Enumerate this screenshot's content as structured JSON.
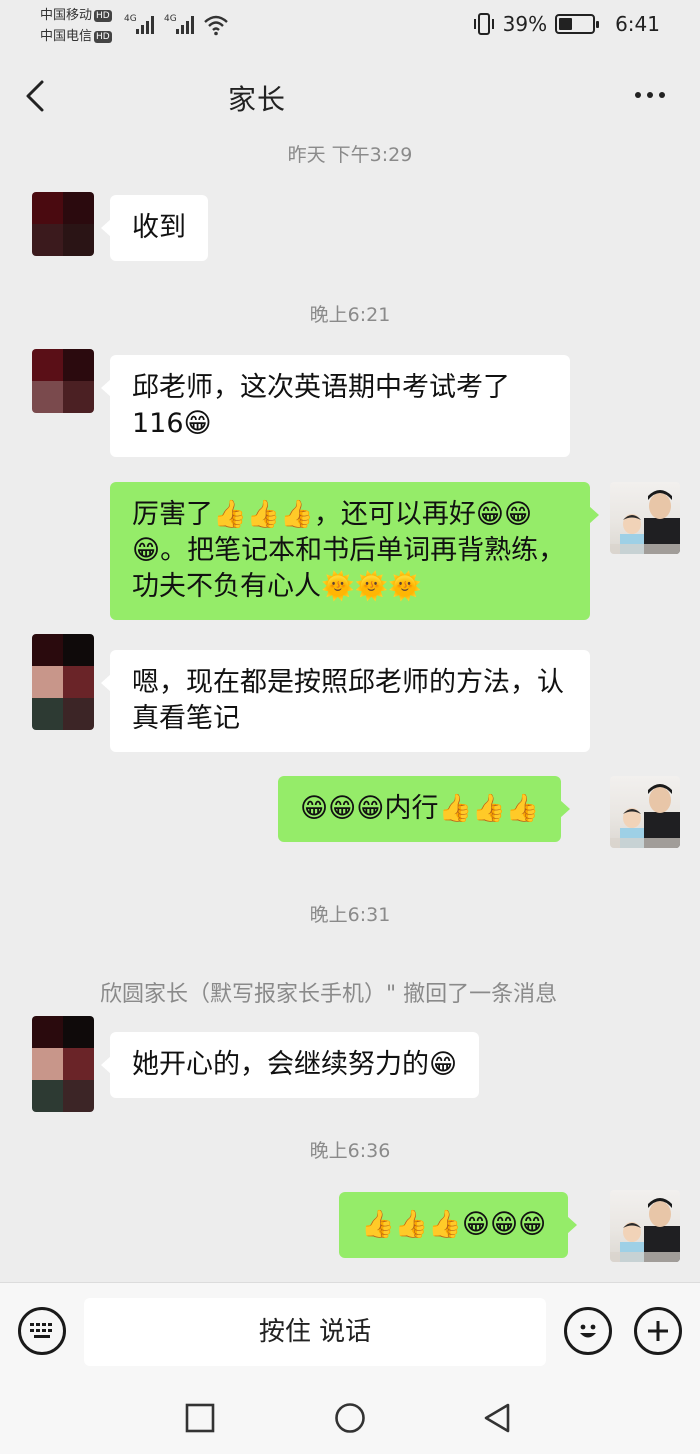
{
  "status_bar": {
    "carrier1": "中国移动",
    "carrier2": "中国电信",
    "hd": "HD",
    "network1": "4G",
    "network2": "4G",
    "battery_percent": "39%",
    "battery_level": 0.39,
    "time": "6:41"
  },
  "header": {
    "title": "家长"
  },
  "messages": {
    "t1": "昨天 下午3:29",
    "m1": "收到",
    "t2": "晚上6:21",
    "m2": "邱老师，这次英语期中考试考了116😁",
    "m3": "厉害了👍👍👍，还可以再好😁😁😁。把笔记本和书后单词再背熟练，功夫不负有心人🌞🌞🌞",
    "m4": "嗯，现在都是按照邱老师的方法，认真看笔记",
    "m5": "😁😁😁内行👍👍👍",
    "t3": "晚上6:31",
    "recall": "欣圆家长（默写报家长手机）\" 撤回了一条消息",
    "m6": "她开心的，会继续努力的😁",
    "t4": "晚上6:36",
    "m7": "👍👍👍😁😁😁"
  },
  "input_bar": {
    "hold_to_talk": "按住 说话"
  },
  "icons": {
    "back": "back-arrow-icon",
    "more": "more-dots-icon",
    "keyboard": "keyboard-icon",
    "emoji": "emoji-icon",
    "plus": "plus-icon",
    "nav_recent": "square-icon",
    "nav_home": "circle-icon",
    "nav_back": "triangle-icon"
  },
  "colors": {
    "outgoing_bubble": "#95ec69",
    "incoming_bubble": "#ffffff",
    "background": "#ededed"
  }
}
